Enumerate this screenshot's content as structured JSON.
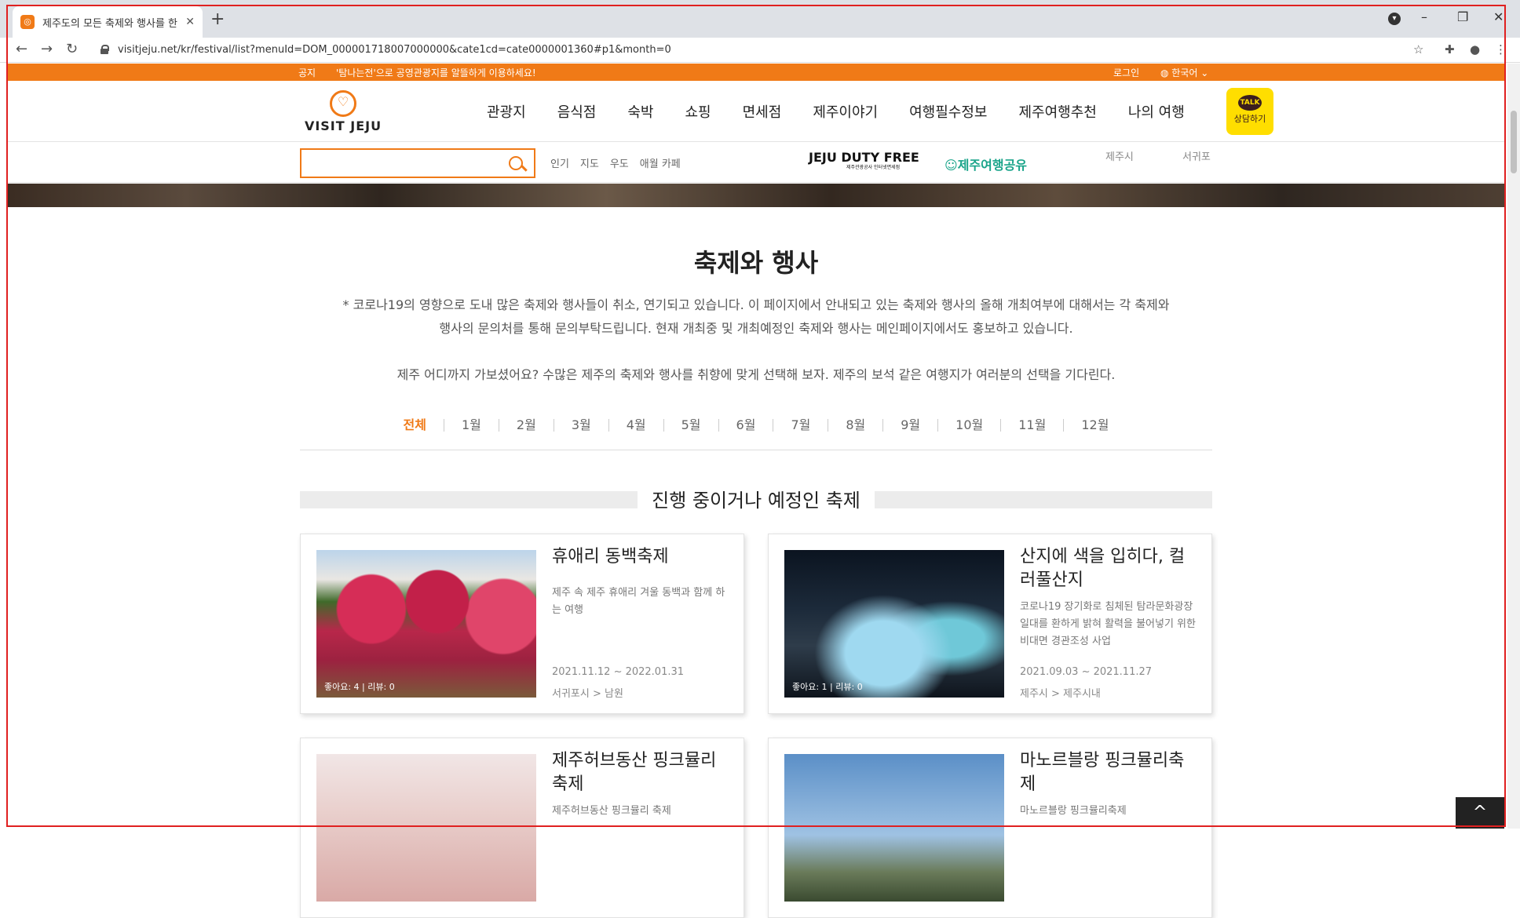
{
  "browser": {
    "tab_title": "제주도의 모든 축제와 행사를 한",
    "url": "visitjeju.net/kr/festival/list?menuId=DOM_000001718007000000&cate1cd=cate0000001360#p1&month=0"
  },
  "notice": {
    "label": "공지",
    "text": "'탐나는전'으로 공영관광지를 알뜰하게 이용하세요!",
    "login": "로그인",
    "language": "한국어"
  },
  "header": {
    "logo_text": "VISIT JEJU",
    "nav": [
      "관광지",
      "음식점",
      "숙박",
      "쇼핑",
      "면세점",
      "제주이야기",
      "여행필수정보",
      "제주여행추천",
      "나의 여행"
    ],
    "talk_bubble": "TALK",
    "talk_label": "상담하기"
  },
  "search": {
    "placeholder": "",
    "keywords": [
      "인기",
      "지도",
      "우도",
      "애월 카페"
    ],
    "dutyfree_title": "JEJU DUTY FREE",
    "dutyfree_sub": "제주관광공사 인터넷면세점",
    "share_label": "제주여행공유",
    "regions": [
      "제주시",
      "서귀포"
    ]
  },
  "main": {
    "title": "축제와 행사",
    "desc_line1": "* 코로나19의 영향으로 도내 많은 축제와 행사들이 취소, 연기되고 있습니다. 이 페이지에서 안내되고 있는 축제와 행사의 올해 개최여부에 대해서는 각 축제와",
    "desc_line2": "행사의 문의처를 통해 문의부탁드립니다. 현재 개최중 및 개최예정인 축제와 행사는 메인페이지에서도 홍보하고 있습니다.",
    "desc_line3": "제주 어디까지 가보셨어요? 수많은 제주의 축제와 행사를 취향에 맞게 선택해 보자. 제주의 보석 같은 여행지가 여러분의 선택을 기다린다.",
    "months": [
      "전체",
      "1월",
      "2월",
      "3월",
      "4월",
      "5월",
      "6월",
      "7월",
      "8월",
      "9월",
      "10월",
      "11월",
      "12월"
    ],
    "section_title": "진행 중이거나 예정인 축제",
    "cards": [
      {
        "title": "휴애리 동백축제",
        "sub": "제주 속 제주 휴애리 겨울 동백과 함께 하는 여행",
        "date": "2021.11.12 ~ 2022.01.31",
        "location": "서귀포시 > 남원",
        "stats": "좋아요: 4 | 리뷰: 0"
      },
      {
        "title": "산지에 색을 입히다, 컬러풀산지",
        "sub": "코로나19 장기화로 침체된 탐라문화광장 일대를 환하게 밝혀 활력을 불어넣기 위한 비대면 경관조성 사업",
        "date": "2021.09.03 ~ 2021.11.27",
        "location": "제주시 > 제주시내",
        "stats": "좋아요: 1 | 리뷰: 0"
      },
      {
        "title": "제주허브동산 핑크뮬리 축제",
        "sub": "제주허브동산 핑크뮬리 축제",
        "date": "",
        "location": "",
        "stats": ""
      },
      {
        "title": "마노르블랑 핑크뮬리축제",
        "sub": "마노르블랑 핑크뮬리축제",
        "date": "",
        "location": "",
        "stats": ""
      }
    ]
  },
  "to_top": "^"
}
